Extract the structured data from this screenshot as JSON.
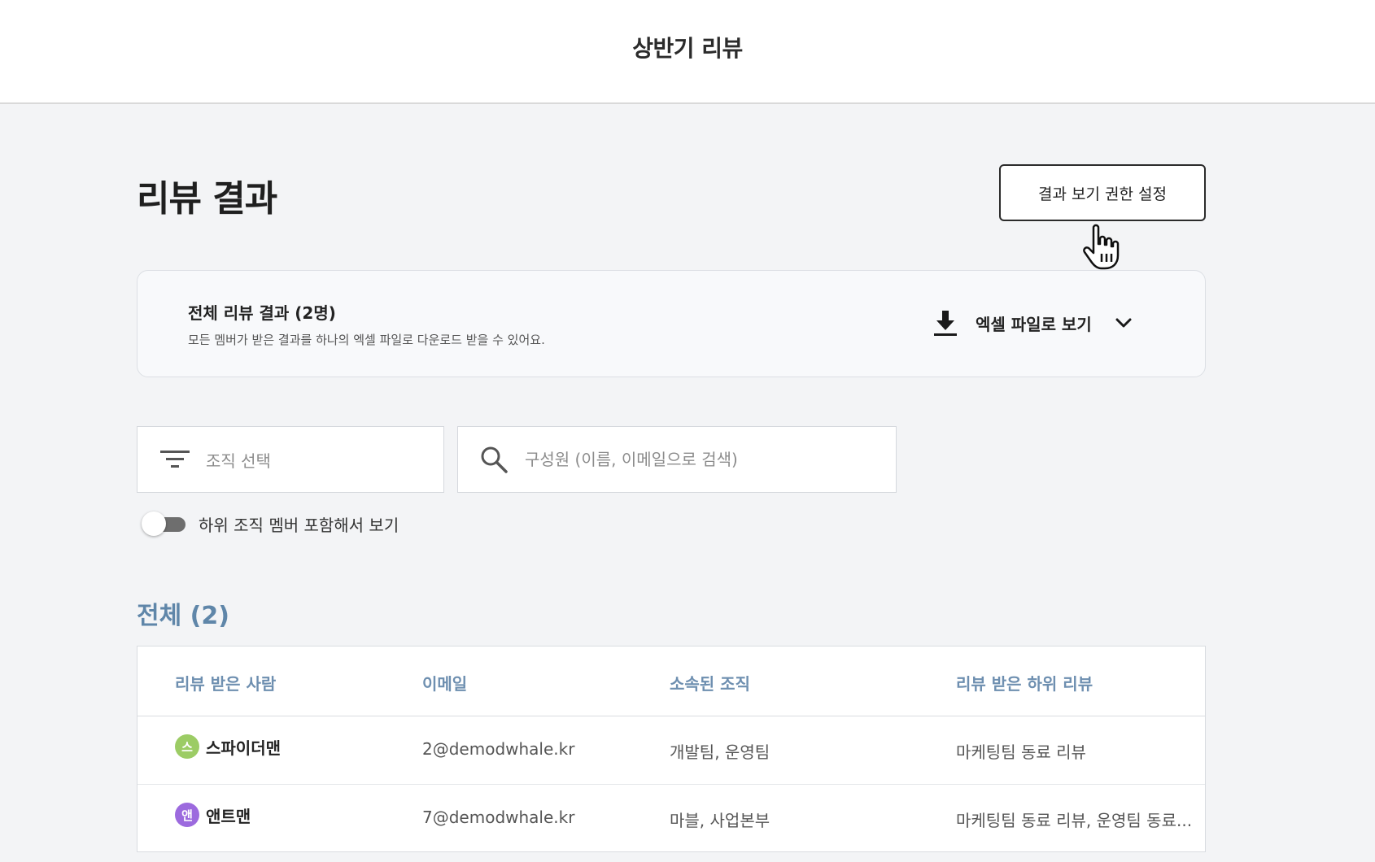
{
  "header": {
    "title": "상반기 리뷰"
  },
  "page": {
    "title": "리뷰 결과",
    "permission_button": "결과 보기 권한 설정"
  },
  "export": {
    "title": "전체 리뷰 결과 (2명)",
    "description": "모든 멤버가 받은 결과를 하나의 엑셀 파일로 다운로드 받을 수 있어요.",
    "action_label": "엑셀 파일로 보기"
  },
  "filters": {
    "org_placeholder": "조직 선택",
    "search_placeholder": "구성원 (이름, 이메일으로 검색)",
    "toggle_label": "하위 조직 멤버 포함해서 보기",
    "toggle_on": false
  },
  "section": {
    "heading": "전체 (2)"
  },
  "table": {
    "columns": [
      "리뷰 받은 사람",
      "이메일",
      "소속된 조직",
      "리뷰 받은 하위 리뷰"
    ],
    "rows": [
      {
        "avatar_initial": "스",
        "avatar_color": "#9ccc65",
        "name": "스파이더맨",
        "email": "2@demodwhale.kr",
        "org": "개발팀, 운영팀",
        "reviews": "마케팅팀 동료 리뷰"
      },
      {
        "avatar_initial": "앤",
        "avatar_color": "#9c6ade",
        "name": "앤트맨",
        "email": "7@demodwhale.kr",
        "org": "마블, 사업본부",
        "reviews": "마케팅팀 동료 리뷰, 운영팀 동료..."
      }
    ]
  },
  "icons": {
    "download": "download-icon",
    "chevron": "chevron-down-icon",
    "filter": "filter-icon",
    "search": "search-icon",
    "cursor": "hand-pointer-icon"
  },
  "colors": {
    "section_heading": "#5f86a9",
    "table_header": "#6e8fb0",
    "background": "#f3f4f6"
  }
}
